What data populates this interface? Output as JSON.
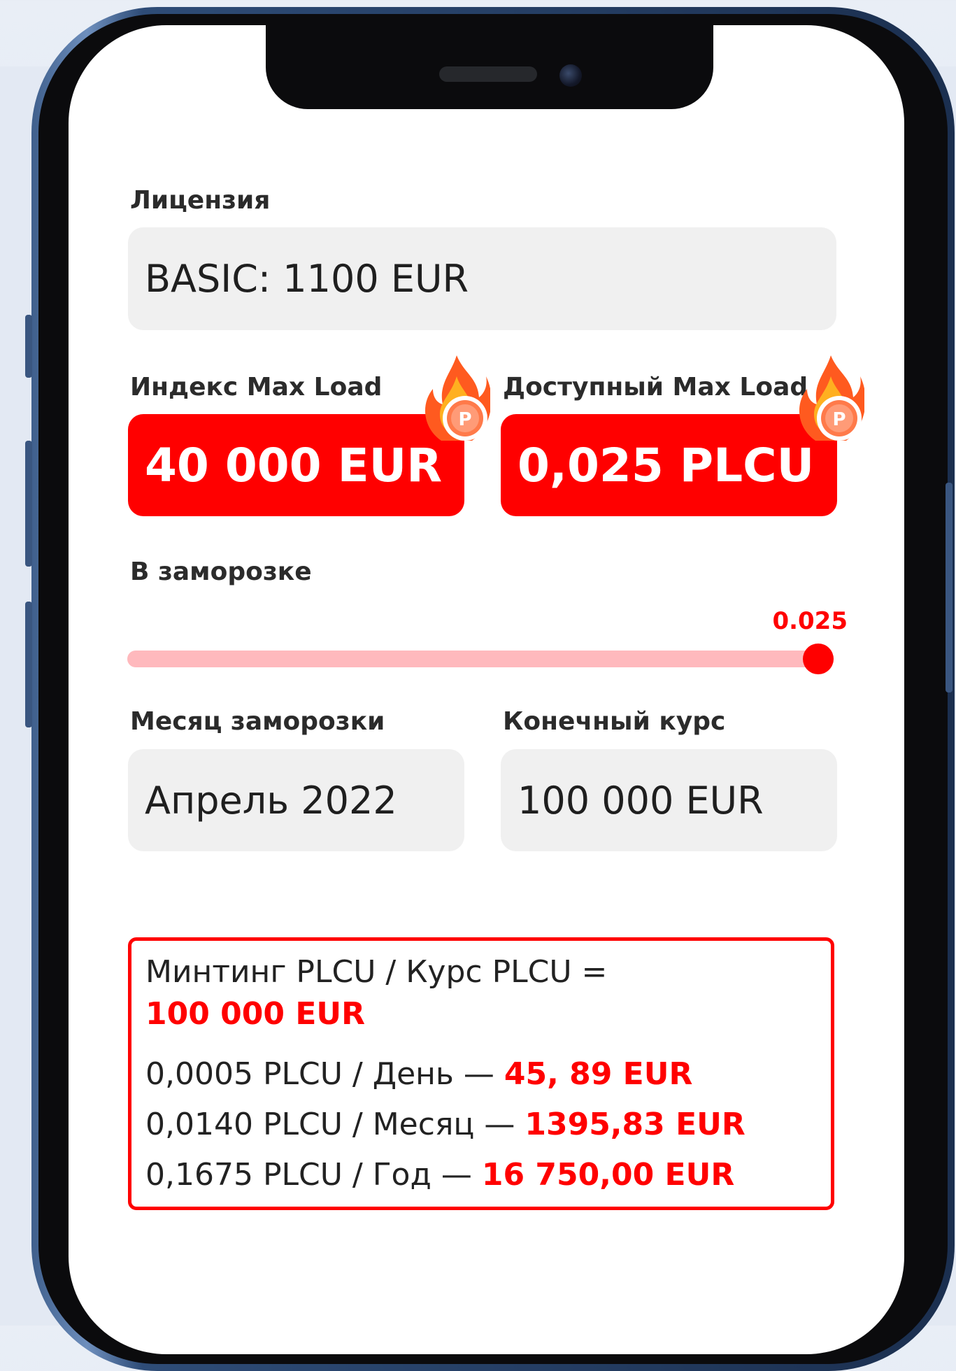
{
  "license": {
    "label": "Лицензия",
    "value": "BASIC: 1100 EUR"
  },
  "index_max_load": {
    "label": "Индекс Max Load",
    "value": "40 000 EUR"
  },
  "available_max_load": {
    "label": "Доступный Max Load",
    "value": "0,025 PLCU"
  },
  "frozen": {
    "label": "В заморозке",
    "value": "0.025",
    "fraction": 1.0
  },
  "freeze_month": {
    "label": "Месяц заморозки",
    "value": "Апрель 2022"
  },
  "final_rate": {
    "label": "Конечный курс",
    "value": "100 000 EUR"
  },
  "result": {
    "formula": "Минтинг PLCU / Курс PLCU =",
    "formula_value": "100 000 EUR",
    "rows": [
      {
        "text": "0,0005 PLCU / День — ",
        "value": "45, 89 EUR"
      },
      {
        "text": "0,0140 PLCU / Месяц — ",
        "value": "1395,83 EUR"
      },
      {
        "text": "0,1675 PLCU / Год  — ",
        "value": "16 750,00 EUR"
      }
    ]
  },
  "colors": {
    "accent": "#ff0000",
    "track": "#ffb9bd",
    "field_bg": "#f0f0f0"
  }
}
